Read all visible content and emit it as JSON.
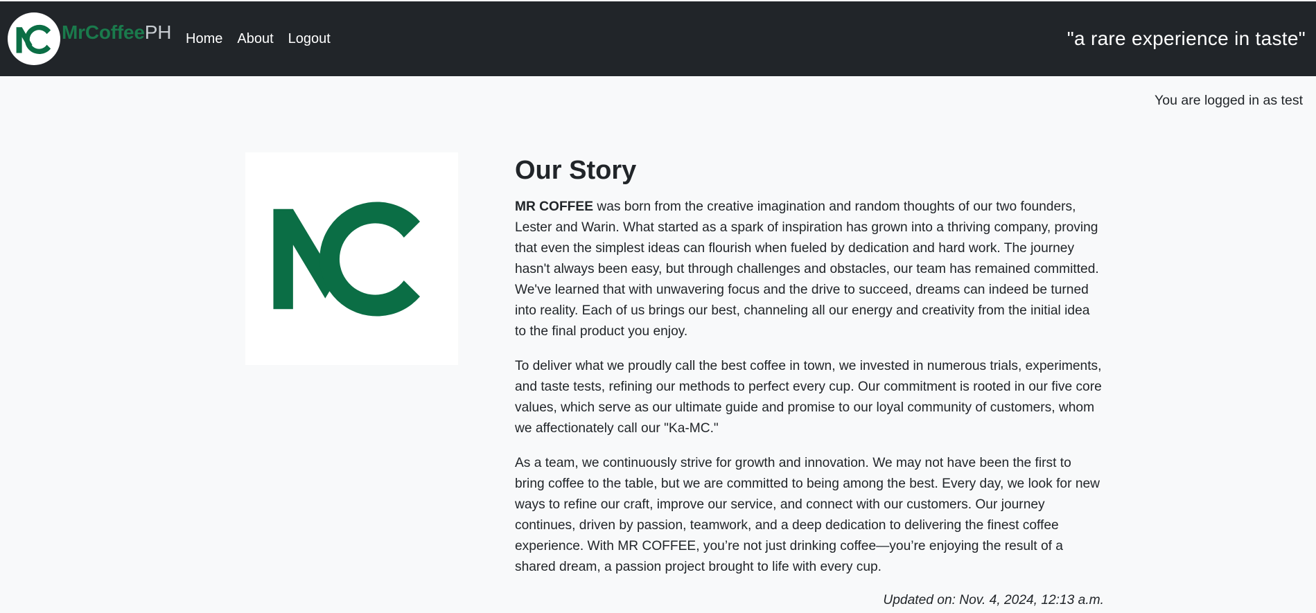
{
  "navbar": {
    "brand": {
      "strong": "MrCoffee",
      "light": "PH",
      "logo_letters": "MC"
    },
    "links": [
      "Home",
      "About",
      "Logout"
    ],
    "tagline": "\"a rare experience in taste\""
  },
  "login_status": "You are logged in as test",
  "story": {
    "title": "Our Story",
    "paragraph1_strong": "MR COFFEE",
    "paragraph1_rest": " was born from the creative imagination and random thoughts of our two founders, Lester and Warin. What started as a spark of inspiration has grown into a thriving company, proving that even the simplest ideas can flourish when fueled by dedication and hard work. The journey hasn't always been easy, but through challenges and obstacles, our team has remained committed. We've learned that with unwavering focus and the drive to succeed, dreams can indeed be turned into reality. Each of us brings our best, channeling all our energy and creativity from the initial idea to the final product you enjoy.",
    "paragraph2": "To deliver what we proudly call the best coffee in town, we invested in numerous trials, experiments, and taste tests, refining our methods to perfect every cup. Our commitment is rooted in our five core values, which serve as our ultimate guide and promise to our loyal community of customers, whom we affectionately call our \"Ka-MC.\"",
    "paragraph3": "As a team, we continuously strive for growth and innovation. We may not have been the first to bring coffee to the table, but we are committed to being among the best. Every day, we look for new ways to refine our craft, improve our service, and connect with our customers. Our journey continues, driven by passion, teamwork, and a deep dedication to delivering the finest coffee experience. With MR COFFEE, you’re not just drinking coffee—you’re enjoying the result of a shared dream, a passion project brought to life with every cup.",
    "updated": "Updated on: Nov. 4, 2024, 12:13 a.m."
  },
  "colors": {
    "navbar_bg": "#212529",
    "brand_green": "#0b6e45",
    "page_bg": "#f8f9fa"
  },
  "icons": {
    "brand_logo": "mc-logo-icon",
    "story_image": "mc-logo-image"
  }
}
